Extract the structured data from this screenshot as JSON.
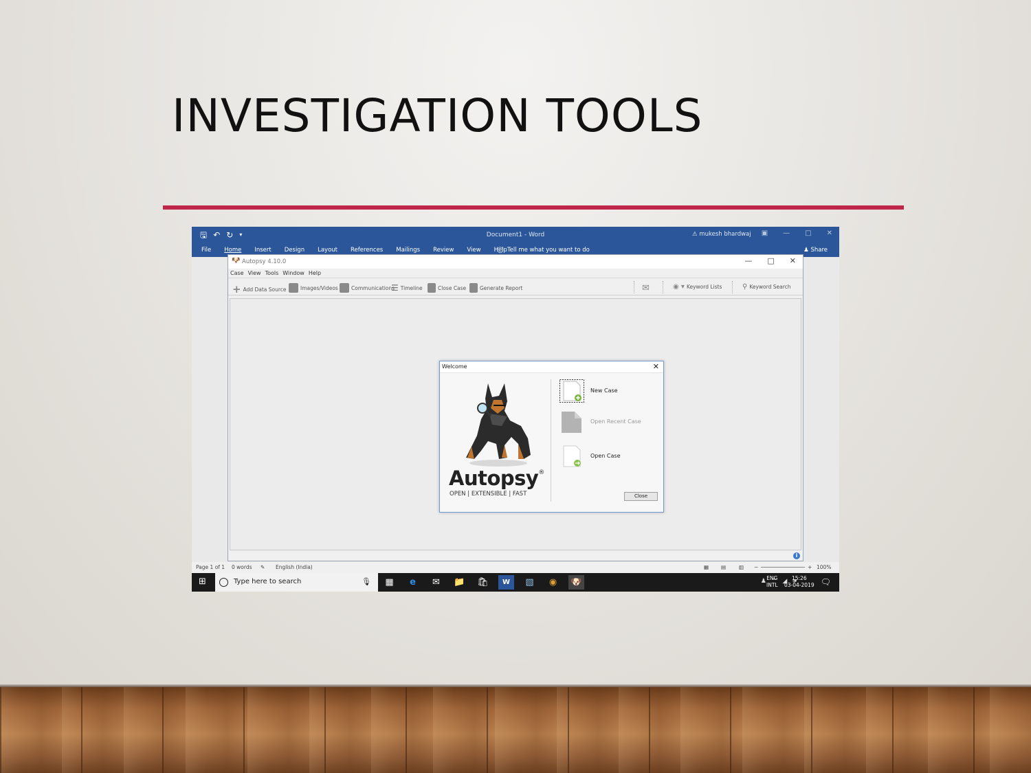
{
  "slide": {
    "title": "INVESTIGATION TOOLS",
    "accent_color": "#c0254a"
  },
  "word": {
    "doc_title": "Document1  -  Word",
    "user_name": "mukesh bhardwaj",
    "tabs": [
      "File",
      "Home",
      "Insert",
      "Design",
      "Layout",
      "References",
      "Mailings",
      "Review",
      "View",
      "Help"
    ],
    "tell_me": "Tell me what you want to do",
    "share": "Share",
    "status": {
      "page": "Page 1 of 1",
      "words": "0 words",
      "language": "English (India)",
      "zoom": "100%"
    },
    "ribbon_color": "#2b579a"
  },
  "taskbar": {
    "search_placeholder": "Type here to search",
    "lang_top": "ENG",
    "lang_bottom": "INTL",
    "time": "15:26",
    "date": "03-04-2019"
  },
  "autopsy": {
    "window_title": "Autopsy 4.10.0",
    "menu": [
      "Case",
      "View",
      "Tools",
      "Window",
      "Help"
    ],
    "toolbar": {
      "add_data_source": "Add Data Source",
      "images_videos": "Images/Videos",
      "communications": "Communications",
      "timeline": "Timeline",
      "close_case": "Close Case",
      "generate_report": "Generate Report",
      "keyword_lists": "Keyword Lists",
      "keyword_search": "Keyword Search"
    },
    "welcome": {
      "title": "Welcome",
      "brand": "Autopsy",
      "registered": "®",
      "tagline": "OPEN | EXTENSIBLE | FAST",
      "new_case": "New Case",
      "open_recent_case": "Open Recent Case",
      "open_case": "Open Case",
      "close": "Close"
    }
  }
}
